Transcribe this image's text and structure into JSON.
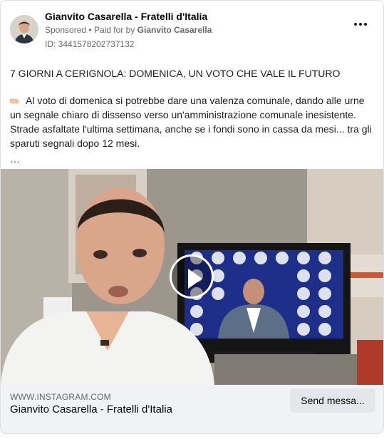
{
  "post": {
    "page_name": "Gianvito Casarella - Fratelli d'Italia",
    "sponsored": "Sponsored",
    "separator": "•",
    "paid_for_prefix": "Paid for by",
    "paid_for_name": "Gianvito Casarella",
    "ad_id": "ID: 344157820273713​2",
    "more_icon": "more-horizontal-icon",
    "headline": "7 GIORNI A CERIGNOLA: DOMENICA, UN VOTO CHE VALE IL FUTURO",
    "body": "Al voto di domenica si potrebbe dare una valenza comunale, dando alle urne un segnale chiaro di dissenso verso un'amministrazione comunale inesistente. Strade asfaltate l'ultima settimana, anche se i fondi sono in cassa da mesi... tra gli sparuti segnali dopo 12 mesi.",
    "see_more": "…",
    "hand_icon": "pointing-hand-emoji"
  },
  "media": {
    "play_icon": "play-icon"
  },
  "footer": {
    "domain": "WWW.INSTAGRAM.COM",
    "title": "Gianvito Casarella - Fratelli d'Italia",
    "cta_label": "Send messa..."
  },
  "colors": {
    "secondary_text": "#65676b",
    "footer_bg": "#f0f2f5",
    "button_bg": "#e4e6eb"
  }
}
